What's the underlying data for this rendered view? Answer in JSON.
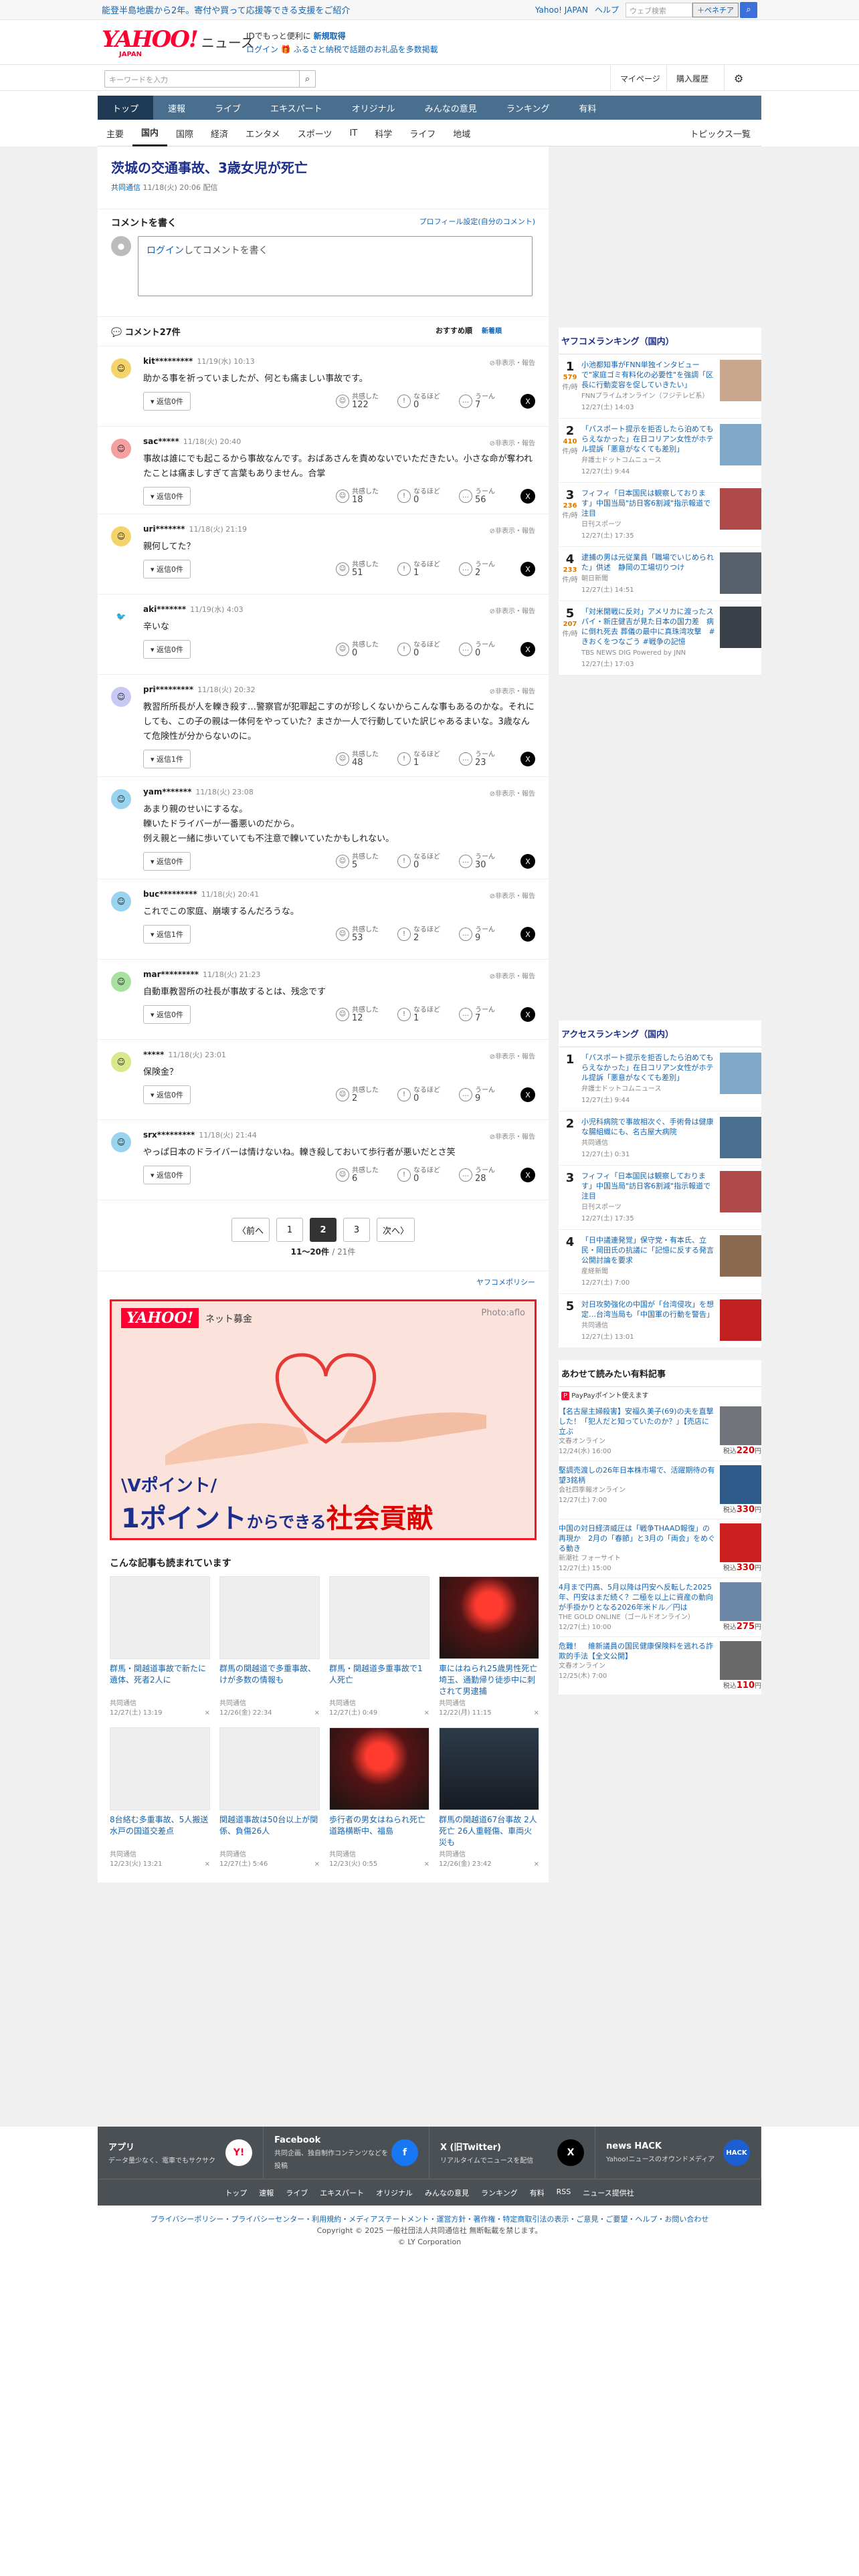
{
  "topbar": {
    "notice": "能登半島地震から2年。寄付や買って応援等できる支援をご紹介",
    "links": [
      "Yahoo! JAPAN",
      "ヘルプ"
    ],
    "search_placeholder": "ウェブ検索",
    "pay_btn": "＋ペネチア"
  },
  "header": {
    "logo": "YAHOO!",
    "logo_sub": "JAPAN",
    "news": "ニュース",
    "promo1_a": "IDでもっと便利に",
    "promo1_b": "新規取得",
    "promo2_login": "ログイン",
    "promo2_text": "ふるさと納税で話題のお礼品を多数掲載"
  },
  "searchbar": {
    "placeholder": "キーワードを入力",
    "mypage": "マイページ",
    "history": "購入履歴"
  },
  "nav_main": [
    "トップ",
    "速報",
    "ライブ",
    "エキスパート",
    "オリジナル",
    "みんなの意見",
    "ランキング",
    "有料"
  ],
  "nav_cat": [
    "主要",
    "国内",
    "国際",
    "経済",
    "エンタメ",
    "スポーツ",
    "IT",
    "科学",
    "ライフ",
    "地域"
  ],
  "nav_topics": "トピックス一覧",
  "article": {
    "title": "茨城の交通事故、3歳女児が死亡",
    "source": "共同通信",
    "date": "11/18(火) 20:06 配信"
  },
  "comment_write": {
    "heading": "コメントを書く",
    "profile": "プロフィール設定(自分のコメント)",
    "login": "ログイン",
    "prompt": "してコメントを書く"
  },
  "comments_header": {
    "count": "コメント27件",
    "sort1": "おすすめ順",
    "sort2": "新着順"
  },
  "comments": [
    {
      "name": "kit*********",
      "time": "11/19(水) 10:13",
      "text": "助かる事を祈っていましたが、何とも痛ましい事故です。",
      "reply": "返信0件",
      "a": "122",
      "b": "0",
      "c": "7",
      "color": "#f3d36a",
      "ic": "☺"
    },
    {
      "name": "sac*****",
      "time": "11/18(火) 20:40",
      "text": "事故は誰にでも起こるから事故なんです。おばあさんを責めないでいただきたい。小さな命が奪われたことは痛ましすぎて言葉もありません。合掌",
      "reply": "返信0件",
      "a": "18",
      "b": "0",
      "c": "56",
      "color": "#f5a0a0",
      "ic": "☺"
    },
    {
      "name": "uri*******",
      "time": "11/18(火) 21:19",
      "text": "親何してた？",
      "reply": "返信0件",
      "a": "51",
      "b": "1",
      "c": "2",
      "color": "#f3d36a",
      "ic": "☺"
    },
    {
      "name": "aki*******",
      "time": "11/19(水) 4:03",
      "text": "辛いな",
      "reply": "返信0件",
      "a": "0",
      "b": "0",
      "c": "0",
      "color": "#ffffff",
      "ic": "🐦"
    },
    {
      "name": "pri*********",
      "time": "11/18(火) 20:32",
      "text": "教習所所長が人を轢き殺す…警察官が犯罪起こすのが珍しくないからこんな事もあるのかな。それにしても、この子の親は一体何をやっていた？まさか一人で行動していた訳じゃあるまいな。3歳なんて危険性が分からないのに。",
      "reply": "返信1件",
      "a": "48",
      "b": "1",
      "c": "23",
      "color": "#c8c8f5",
      "ic": "☺"
    },
    {
      "name": "yam*******",
      "time": "11/18(火) 23:08",
      "text": "あまり親のせいにするな。\n轢いたドライバーが一番悪いのだから。\n例え親と一緒に歩いていても不注意で轢いていたかもしれない。",
      "reply": "返信0件",
      "a": "5",
      "b": "0",
      "c": "30",
      "color": "#9ad3f0",
      "ic": "☺"
    },
    {
      "name": "buc*********",
      "time": "11/18(火) 20:41",
      "text": "これでこの家庭、崩壊するんだろうな。",
      "reply": "返信1件",
      "a": "53",
      "b": "2",
      "c": "9",
      "color": "#9ad3f0",
      "ic": "☺"
    },
    {
      "name": "mar*********",
      "time": "11/18(火) 21:23",
      "text": "自動車教習所の社長が事故するとは、残念です",
      "reply": "返信0件",
      "a": "12",
      "b": "1",
      "c": "7",
      "color": "#a8e0a0",
      "ic": "☺"
    },
    {
      "name": "*****",
      "time": "11/18(火) 23:01",
      "text": "保険金？",
      "reply": "返信0件",
      "a": "2",
      "b": "0",
      "c": "9",
      "color": "#d8e88a",
      "ic": "☺"
    },
    {
      "name": "srx*********",
      "time": "11/18(火) 21:44",
      "text": "やっぱ日本のドライバーは情けないね。轢き殺しておいて歩行者が悪いだとさ笑",
      "reply": "返信0件",
      "a": "6",
      "b": "0",
      "c": "28",
      "color": "#9ad3f0",
      "ic": "☺"
    }
  ],
  "act_labels": {
    "a": "共感した",
    "b": "なるほど",
    "c": "うーん",
    "report": "非表示・報告"
  },
  "pager": {
    "prev": "〈前へ",
    "pages": [
      "1",
      "2",
      "3"
    ],
    "current": "2",
    "next": "次へ〉",
    "count": "11〜20件",
    "total": "/ 21件"
  },
  "policy": "ヤフコメポリシー",
  "ad": {
    "brand": "YAHOO!",
    "sub": "ネット募金",
    "photo": "Photo:aflo",
    "l1": "\\Vポイント/",
    "l2a": "1ポイント",
    "l2b": "からできる",
    "l2c": "社会貢献"
  },
  "more": {
    "title": "こんな記事も読まれています",
    "items": [
      {
        "t": "群馬・関越道事故で新たに遺体、死者2人に",
        "s": "共同通信",
        "d": "12/27(土) 13:19",
        "img": ""
      },
      {
        "t": "群馬の関越道で多重事故、けが多数の情報も",
        "s": "共同通信",
        "d": "12/26(金) 22:34",
        "img": ""
      },
      {
        "t": "群馬・関越道多重事故で1人死亡",
        "s": "共同通信",
        "d": "12/27(土) 0:49",
        "img": ""
      },
      {
        "t": "車にはねられ25歳男性死亡 埼玉、通勤帰り徒歩中に刺されて男逮捕",
        "s": "共同通信",
        "d": "12/22(月) 11:15",
        "img": "red"
      },
      {
        "t": "8台絡む多重事故、5人搬送 水戸の国道交差点",
        "s": "共同通信",
        "d": "12/23(火) 13:21",
        "img": ""
      },
      {
        "t": "関越道事故は50台以上が関係、負傷26人",
        "s": "共同通信",
        "d": "12/27(土) 5:46",
        "img": ""
      },
      {
        "t": "歩行者の男女はねられ死亡 道路横断中、福島",
        "s": "共同通信",
        "d": "12/23(火) 0:55",
        "img": "red"
      },
      {
        "t": "群馬の関越道67台事故 2人死亡 26人重軽傷、車両火災も",
        "s": "共同通信",
        "d": "12/26(金) 23:42",
        "img": "dark"
      }
    ]
  },
  "side_rank": {
    "title": "ヤフコメランキング（国内）",
    "items": [
      {
        "no": "1",
        "cnt": "579",
        "t": "小池都知事がFNN単独インタビューで\"家庭ゴミ有料化の必要性\"を強調「区長に行動変容を促していきたい」",
        "s": "FNNプライムオンライン（フジテレビ系）",
        "d": "12/27(土) 14:03",
        "th": "#c9a78f"
      },
      {
        "no": "2",
        "cnt": "410",
        "t": "「パスポート提示を拒否したら泊めてもらえなかった」在日コリアン女性がホテル提訴「悪意がなくても差別」",
        "s": "弁護士ドットコムニュース",
        "d": "12/27(土) 9:44",
        "th": "#7fa8c9"
      },
      {
        "no": "3",
        "cnt": "236",
        "t": "フィフィ「日本国民は観察しております」中国当局\"訪日客6割減\"指示報道で注目",
        "s": "日刊スポーツ",
        "d": "12/27(土) 17:35",
        "th": "#b04a4a"
      },
      {
        "no": "4",
        "cnt": "233",
        "t": "逮捕の男は元従業員「職場でいじめられた」供述　静岡の工場切りつけ",
        "s": "朝日新聞",
        "d": "12/27(土) 14:51",
        "th": "#55606a"
      },
      {
        "no": "5",
        "cnt": "207",
        "t": "「対米開戦に反対」アメリカに渡ったスパイ・新庄健吉が見た日本の国力差　病に倒れ死去 葬儀の最中に真珠湾攻撃　#きおくをつなごう #戦争の記憶",
        "s": "TBS NEWS DIG Powered by JNN",
        "d": "12/27(土) 17:03",
        "th": "#3a4048"
      }
    ]
  },
  "side_access": {
    "title": "アクセスランキング（国内）",
    "items": [
      {
        "no": "1",
        "t": "「パスポート提示を拒否したら泊めてもらえなかった」在日コリアン女性がホテル提訴「悪意がなくても差別」",
        "s": "弁護士ドットコムニュース",
        "d": "12/27(土) 9:44",
        "th": "#7fa8c9"
      },
      {
        "no": "2",
        "t": "小児科病院で事故相次ぐ、手術骨は健康な腸組織にも、名古屋大病院",
        "s": "共同通信",
        "d": "12/27(土) 0:31",
        "th": "#4a6f8f"
      },
      {
        "no": "3",
        "t": "フィフィ「日本国民は観察しております」中国当局\"訪日客6割減\"指示報道で注目",
        "s": "日刊スポーツ",
        "d": "12/27(土) 17:35",
        "th": "#b04a4a"
      },
      {
        "no": "4",
        "t": "「日中議連発覚」保守党・有本氏、立民・岡田氏の抗議に「記憶に反する発言　公開討論を要求",
        "s": "産経新聞",
        "d": "12/27(土) 7:00",
        "th": "#8a6a50"
      },
      {
        "no": "5",
        "t": "対日攻勢強化の中国が「台湾侵攻」を想定…台湾当局も「中国軍の行動を警告」",
        "s": "共同通信",
        "d": "12/27(土) 13:01",
        "th": "#c02020"
      }
    ]
  },
  "side_prod": {
    "title": "あわせて読みたい有料記事",
    "paypay": "PayPayポイント使えます",
    "items": [
      {
        "t": "【名古屋主婦殺害】安福久美子(69)の夫を直撃した！「犯人だと知っていたのか？」【売店に立ぶ",
        "s": "文春オンライン",
        "d": "12/24(水) 16:00",
        "pr": "220",
        "th": "#70737a"
      },
      {
        "t": "堅調売渡しの26年日本株市場で、活躍期待の有望3銘柄",
        "s": "会社四季報オンライン",
        "d": "12/27(土) 7:00",
        "pr": "330",
        "th": "#2e5a8a"
      },
      {
        "t": "中国の対日経済威圧は「戦争THAAD報復」の再現か　2月の「春節」と3月の「両会」をめぐる動き",
        "s": "新潮社 フォーサイト",
        "d": "12/27(土) 15:00",
        "pr": "330",
        "th": "#cc2020"
      },
      {
        "t": "4月まで円高、5月以降は円安へ反転した2025年、円安はまだ続く？二極を以上に資産の動向が手掛かりとなる2026年米ドル／円は",
        "s": "THE GOLD ONLINE（ゴールドオンライン）",
        "d": "12/27(土) 10:00",
        "pr": "275",
        "th": "#6b86a6"
      },
      {
        "t": "危難！　維新議員の国民健康保険料を逃れる詐欺的手法【全文公開】",
        "s": "文春オンライン",
        "d": "12/25(木) 7:00",
        "pr": "110",
        "th": "#6a6a6a"
      }
    ]
  },
  "footer": {
    "apps": [
      {
        "name": "アプリ",
        "desc": "データ量少なく、電車でもサクサク",
        "icon": "Y!",
        "bg": "#ffffff",
        "fg": "#ff0033"
      },
      {
        "name": "Facebook",
        "desc": "共同企画、独自制作コンテンツなどを投稿",
        "icon": "f",
        "bg": "#1877f2",
        "fg": "#ffffff"
      },
      {
        "name": "X (旧Twitter)",
        "desc": "リアルタイムでニュースを配信",
        "icon": "X",
        "bg": "#000000",
        "fg": "#ffffff"
      },
      {
        "name": "news HACK",
        "desc": "Yahoo!ニュースのオウンドメディア",
        "icon": "HACK",
        "bg": "#1d5fd0",
        "fg": "#ffffff"
      }
    ],
    "links": [
      "トップ",
      "速報",
      "ライブ",
      "エキスパート",
      "オリジナル",
      "みんなの意見",
      "ランキング",
      "有料",
      "RSS",
      "ニュース提供社"
    ]
  },
  "legal": {
    "links": "プライバシーポリシー・プライバシーセンター・利用規約・メディアステートメント・運営方針・著作権・特定商取引法の表示・ご意見・ご要望・ヘルプ・お問い合わせ",
    "copy": "Copyright © 2025 一般社団法人共同通信社 無断転載を禁じます。",
    "corp": "© LY Corporation"
  }
}
